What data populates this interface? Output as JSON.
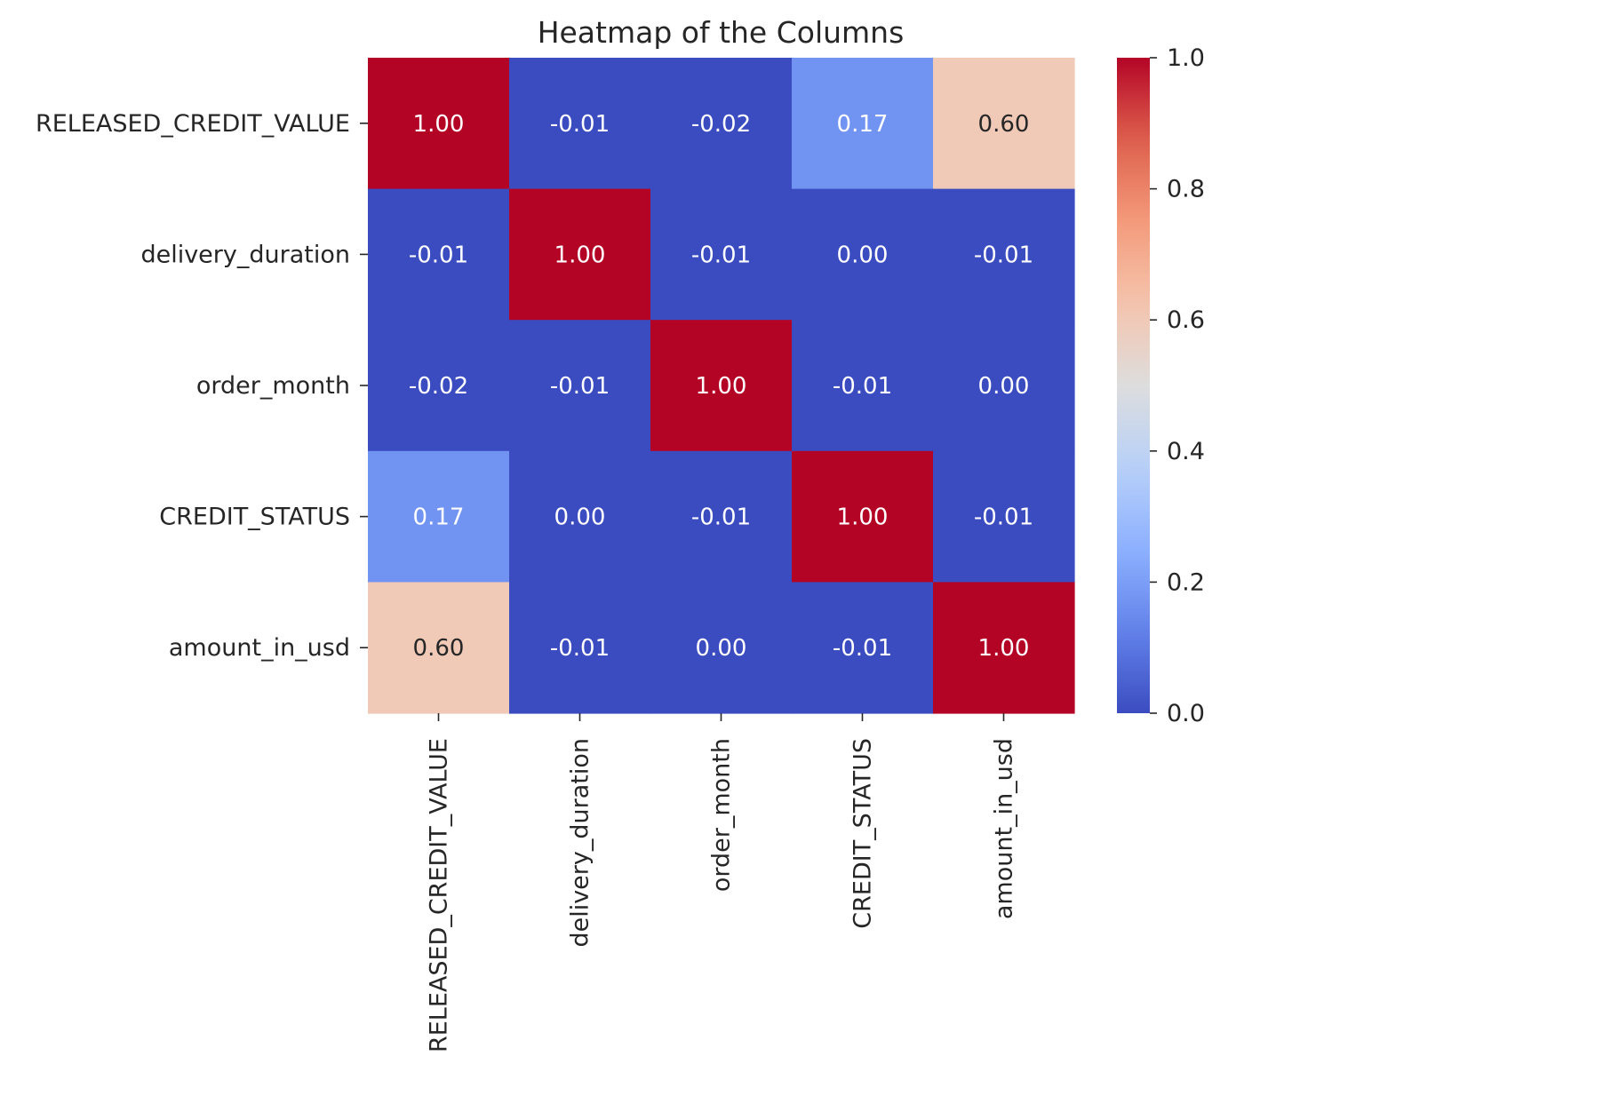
{
  "chart_data": {
    "type": "heatmap",
    "title": "Heatmap of the Columns",
    "xlabel": "",
    "ylabel": "",
    "row_labels": [
      "RELEASED_CREDIT_VALUE",
      "delivery_duration",
      "order_month",
      "CREDIT_STATUS",
      "amount_in_usd"
    ],
    "col_labels": [
      "RELEASED_CREDIT_VALUE",
      "delivery_duration",
      "order_month",
      "CREDIT_STATUS",
      "amount_in_usd"
    ],
    "values": [
      [
        1.0,
        -0.01,
        -0.02,
        0.17,
        0.6
      ],
      [
        -0.01,
        1.0,
        -0.01,
        0.0,
        -0.01
      ],
      [
        -0.02,
        -0.01,
        1.0,
        -0.01,
        0.0
      ],
      [
        0.17,
        0.0,
        -0.01,
        1.0,
        -0.01
      ],
      [
        0.6,
        -0.01,
        0.0,
        -0.01,
        1.0
      ]
    ],
    "annotation_format": "0.00",
    "colormap": "coolwarm",
    "colorbar": {
      "range": [
        0.0,
        1.0
      ],
      "ticks": [
        0.0,
        0.2,
        0.4,
        0.6,
        0.8,
        1.0
      ],
      "tick_labels": [
        "0.0",
        "0.2",
        "0.4",
        "0.6",
        "0.8",
        "1.0"
      ],
      "placement": "right"
    },
    "colors": {
      "low": "#3b4cc0",
      "mid": "#dddddd",
      "high": "#b40426",
      "text_light": "#ffffff",
      "text_dark": "#262626"
    }
  }
}
